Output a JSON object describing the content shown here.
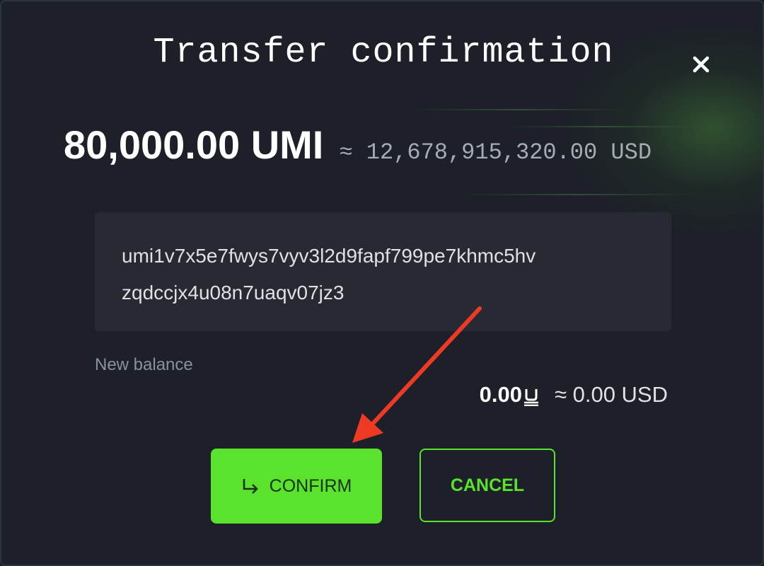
{
  "dialog": {
    "title": "Transfer confirmation"
  },
  "transfer": {
    "amount": "80,000.00 UMI",
    "usd_equivalent": "≈ 12,678,915,320.00 USD",
    "address_line_1": "umi1v7x5e7fwys7vyv3l2d9fapf799pe7khmc5hv",
    "address_line_2": "zqdccjx4u08n7uaqv07jz3"
  },
  "balance": {
    "label": "New balance",
    "value": "0.00",
    "currency_icon": "umi-currency-icon",
    "usd": "≈ 0.00 USD"
  },
  "buttons": {
    "confirm_label": "CONFIRM",
    "confirm_icon": "enter-arrow-icon",
    "cancel_label": "CANCEL",
    "close_icon": "close-icon"
  },
  "colors": {
    "accent": "#5ae22c",
    "background": "#1d2028",
    "address_box": "#272a32",
    "annotation_arrow": "#ee3a24"
  }
}
